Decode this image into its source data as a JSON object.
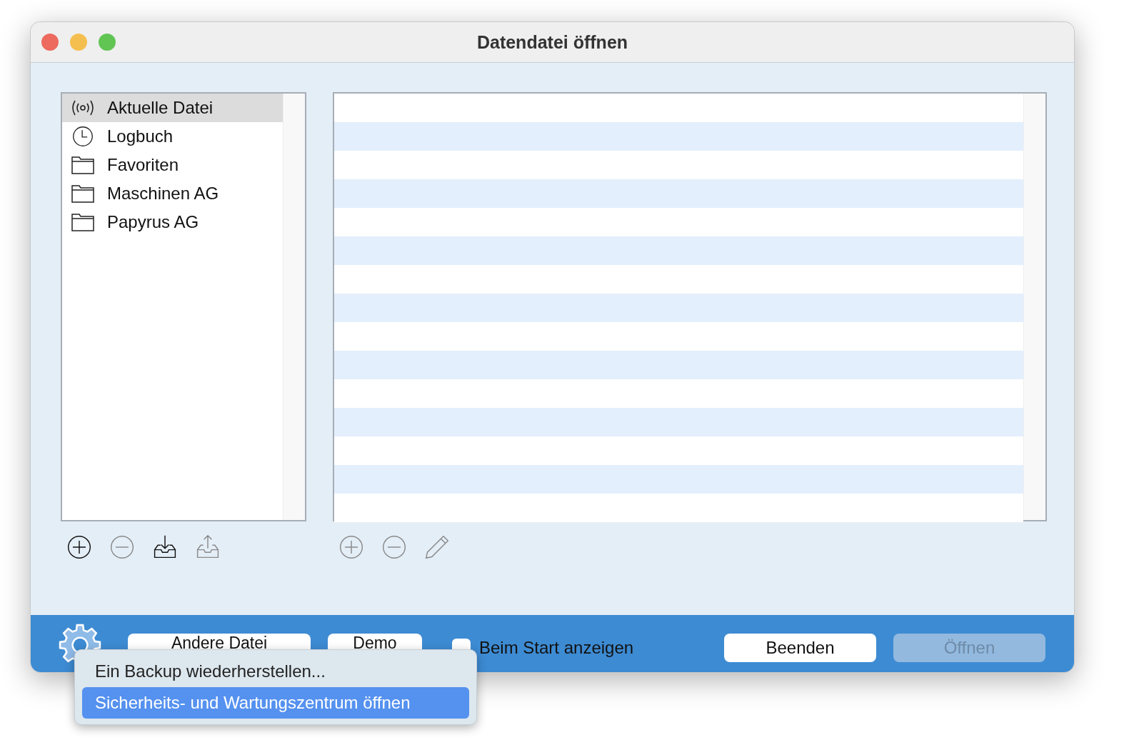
{
  "window": {
    "title": "Datendatei öffnen"
  },
  "sources": [
    {
      "label": "Aktuelle Datei",
      "kind": "broadcast",
      "selected": true
    },
    {
      "label": "Logbuch",
      "kind": "clock",
      "selected": false
    },
    {
      "label": "Favoriten",
      "kind": "folder",
      "selected": false
    },
    {
      "label": "Maschinen AG",
      "kind": "folder",
      "selected": false
    },
    {
      "label": "Papyrus AG",
      "kind": "folder",
      "selected": false
    }
  ],
  "source_tools": [
    {
      "kind": "add",
      "disabled": false
    },
    {
      "kind": "remove",
      "disabled": true
    },
    {
      "kind": "import",
      "disabled": false
    },
    {
      "kind": "export",
      "disabled": true
    }
  ],
  "file_tools": [
    {
      "kind": "add",
      "disabled": true
    },
    {
      "kind": "remove",
      "disabled": true
    },
    {
      "kind": "edit",
      "disabled": true
    }
  ],
  "footer": {
    "buttons": [
      {
        "label": "Andere Datei"
      },
      {
        "label": "Demo"
      }
    ],
    "checkbox": {
      "label": "Beim Start anzeigen",
      "checked": false
    },
    "actions": [
      {
        "label": "Beenden",
        "disabled": false
      },
      {
        "label": "Öffnen",
        "disabled": true
      }
    ]
  },
  "menu": [
    {
      "label": "Ein Backup wiederherstellen...",
      "selected": false
    },
    {
      "label": "Sicherheits- und Wartungszentrum öffnen",
      "selected": true
    }
  ]
}
